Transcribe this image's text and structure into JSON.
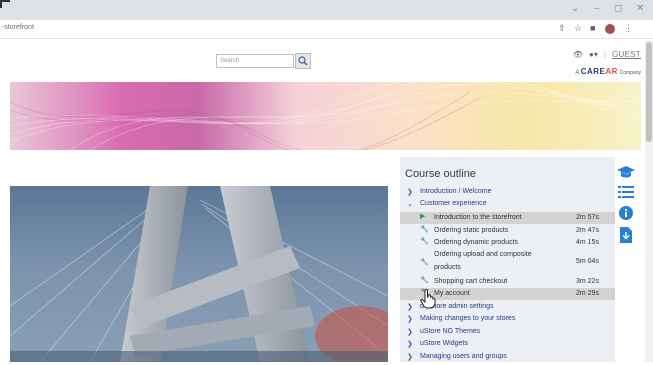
{
  "browser": {
    "url": "-storefront"
  },
  "header": {
    "search_placeholder": "Search",
    "guest_label": "GUEST",
    "brand_prefix": "A",
    "brand_name_1": "CARE",
    "brand_name_2": "AR",
    "brand_suffix": "Company"
  },
  "outline": {
    "title": "Course outline",
    "items": [
      {
        "type": "section",
        "expanded": false,
        "label": "Introduction / Welcome"
      },
      {
        "type": "section",
        "expanded": true,
        "label": "Customer experience"
      },
      {
        "type": "lesson",
        "icon": "play-icon",
        "label": "Introduction to the storefront",
        "duration": "2m 57s"
      },
      {
        "type": "lesson",
        "icon": "wrench-icon",
        "label": "Ordering static products",
        "duration": "2m 47s"
      },
      {
        "type": "lesson",
        "icon": "wrench-icon",
        "label": "Ordering dynamic products",
        "duration": "4m 15s"
      },
      {
        "type": "lesson",
        "icon": "wrench-icon",
        "label_1": "Ordering upload and composite",
        "label_2": "products",
        "duration": "5m 04s"
      },
      {
        "type": "lesson",
        "icon": "wrench-icon",
        "label": "Shopping cart checkout",
        "duration": "3m 22s"
      },
      {
        "type": "lesson",
        "icon": "wrench-icon",
        "label": "My account",
        "duration": "2m 29s"
      },
      {
        "type": "section",
        "expanded": false,
        "label": "uStore admin settings",
        "label_partial": "d uStore admin settings"
      },
      {
        "type": "section",
        "expanded": false,
        "label": "Making changes to your stores"
      },
      {
        "type": "section",
        "expanded": false,
        "label": "uStore NG Themes"
      },
      {
        "type": "section",
        "expanded": false,
        "label": "uStore Widgets"
      },
      {
        "type": "section",
        "expanded": false,
        "label": "Managing users and groups"
      }
    ]
  },
  "colors": {
    "accent": "#2a7fd4",
    "section_text": "#2a3a8c",
    "panel_bg": "#eceff3",
    "highlight": "#d3d3d3",
    "play": "#2e9a3e"
  }
}
